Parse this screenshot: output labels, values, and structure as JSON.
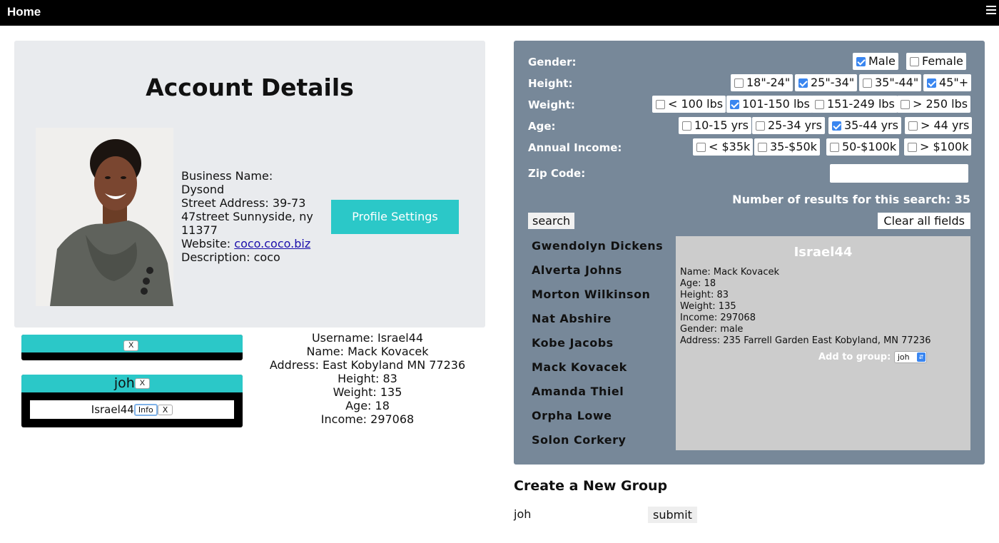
{
  "topbar": {
    "home": "Home"
  },
  "account": {
    "title": "Account Details",
    "business_name_label": "Business Name:",
    "business_name": "Dysond",
    "street_label": "Street Address:",
    "street": "39-73 47street Sunnyside, ny 11377",
    "website_label": "Website:",
    "website": "coco.coco.biz",
    "description_label": "Description:",
    "description": "coco",
    "profile_button": "Profile Settings"
  },
  "groups": [
    {
      "name": "",
      "close": "X",
      "members": []
    },
    {
      "name": "joh",
      "close": "X",
      "members": [
        {
          "username": "Israel44",
          "info": "Info",
          "remove": "X"
        }
      ]
    }
  ],
  "selected_user": {
    "username": "Username: Israel44",
    "name": "Name: Mack Kovacek",
    "address": "Address: East Kobyland MN 77236",
    "height": "Height: 83",
    "weight": "Weight: 135",
    "age": "Age: 18",
    "income": "Income: 297068"
  },
  "filters": {
    "gender_label": "Gender:",
    "gender_options": [
      {
        "label": "Male",
        "checked": true
      },
      {
        "label": "Female",
        "checked": false
      }
    ],
    "height_label": "Height:",
    "height_options": [
      {
        "label": "18\"-24\"",
        "checked": false
      },
      {
        "label": "25\"-34\"",
        "checked": true
      },
      {
        "label": "35\"-44\"",
        "checked": false
      },
      {
        "label": "45\"+",
        "checked": true
      }
    ],
    "weight_label": "Weight:",
    "weight_options": [
      {
        "label": "< 100 lbs",
        "checked": false
      },
      {
        "label": "101-150 lbs",
        "checked": true
      },
      {
        "label": "151-249 lbs",
        "checked": false
      },
      {
        "label": "> 250 lbs",
        "checked": false
      }
    ],
    "age_label": "Age:",
    "age_options": [
      {
        "label": "10-15 yrs",
        "checked": false
      },
      {
        "label": "25-34 yrs",
        "checked": false
      },
      {
        "label": "35-44 yrs",
        "checked": true
      },
      {
        "label": "> 44 yrs",
        "checked": false
      }
    ],
    "income_label": "Annual Income:",
    "income_options": [
      {
        "label": "< $35k",
        "checked": false
      },
      {
        "label": "35-$50k",
        "checked": false
      },
      {
        "label": "50-$100k",
        "checked": false
      },
      {
        "label": "> $100k",
        "checked": false
      }
    ],
    "zip_label": "Zip Code:",
    "zip_value": ""
  },
  "results": {
    "count_text": "Number of results for this search: 35",
    "search_button": "search",
    "clear_button": "Clear all fields",
    "names": [
      "Gwendolyn Dickens",
      "Alverta Johns",
      "Morton Wilkinson",
      "Nat Abshire",
      "Kobe Jacobs",
      "Mack Kovacek",
      "Amanda Thiel",
      "Orpha Lowe",
      "Solon Corkery"
    ]
  },
  "card": {
    "title": "Israel44",
    "name": "Name: Mack Kovacek",
    "age": "Age: 18",
    "height": "Height: 83",
    "weight": "Weight: 135",
    "income": "Income: 297068",
    "gender": "Gender: male",
    "address": "Address: 235 Farrell Garden East Kobyland, MN 77236",
    "add_to_group_label": "Add to group:",
    "add_to_group_value": "joh"
  },
  "create_group": {
    "title": "Create a New Group",
    "input_value": "joh",
    "submit": "submit"
  }
}
